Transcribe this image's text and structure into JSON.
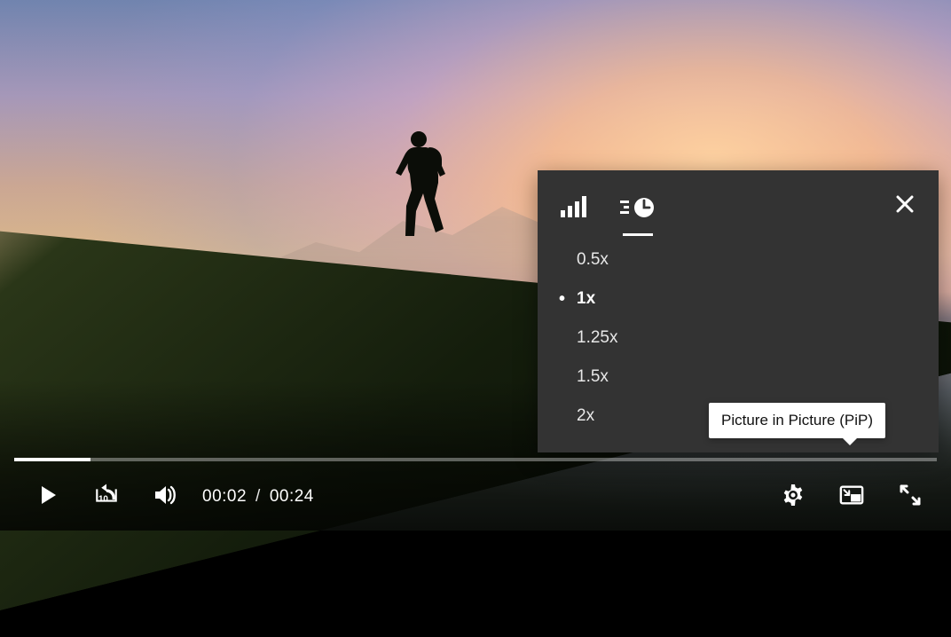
{
  "player": {
    "currentTime": "00:02",
    "duration": "00:24",
    "timeSeparator": "/",
    "progressPercent": 8.3
  },
  "settingsPanel": {
    "tabs": {
      "quality": "quality",
      "speed": "speed"
    },
    "activeTab": "speed",
    "speedOptions": [
      {
        "label": "0.5x",
        "selected": false
      },
      {
        "label": "1x",
        "selected": true
      },
      {
        "label": "1.25x",
        "selected": false
      },
      {
        "label": "1.5x",
        "selected": false
      },
      {
        "label": "2x",
        "selected": false
      }
    ]
  },
  "tooltip": {
    "pip": "Picture in Picture (PiP)"
  },
  "icons": {
    "play": "play-icon",
    "rewind10": "rewind-10-icon",
    "volume": "volume-icon",
    "settings": "gear-icon",
    "pip": "pip-icon",
    "fullscreen": "fullscreen-icon",
    "close": "close-icon",
    "qualityBars": "quality-bars-icon",
    "speedClock": "speed-clock-icon"
  }
}
